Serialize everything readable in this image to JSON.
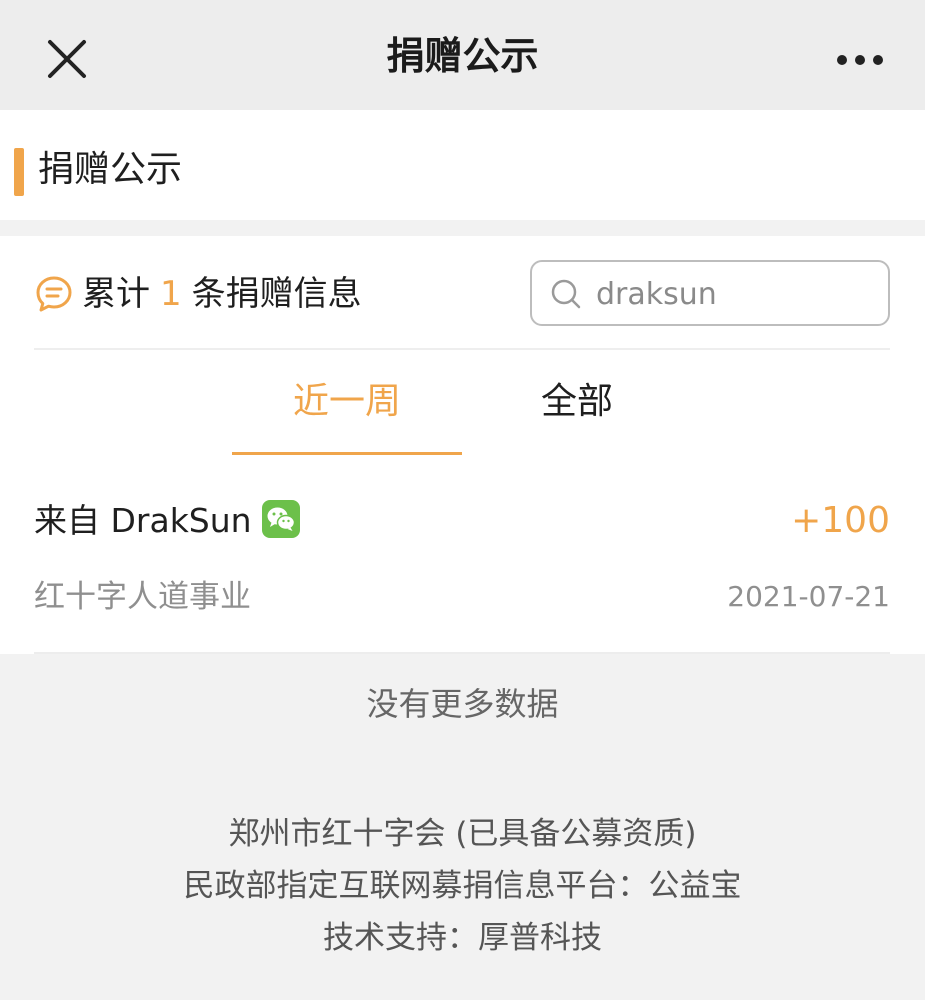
{
  "navbar": {
    "title": "捐赠公示",
    "close_icon": "close-icon",
    "more_icon": "more-dots-icon"
  },
  "section": {
    "title": "捐赠公示",
    "accent_color": "#f0a54b"
  },
  "summary": {
    "prefix": "累计",
    "count": "1",
    "suffix": "条捐赠信息",
    "icon": "chat-bubble-icon"
  },
  "search": {
    "value": "draksun",
    "icon": "search-icon"
  },
  "tabs": [
    {
      "label": "近一周",
      "active": true
    },
    {
      "label": "全部",
      "active": false
    }
  ],
  "donations": [
    {
      "donor": "来自 DrakSun",
      "source_icon": "wechat-icon",
      "amount": "+100",
      "project": "红十字人道事业",
      "date": "2021-07-21"
    }
  ],
  "no_more": "没有更多数据",
  "footer": {
    "line1": "郑州市红十字会 (已具备公募资质)",
    "line2": "民政部指定互联网募捐信息平台：公益宝",
    "line3": "技术支持：厚普科技"
  },
  "colors": {
    "accent": "#f0a54b",
    "wechat_green": "#6cc04a",
    "navbar_bg": "#ededed",
    "page_bg": "#f2f2f2"
  }
}
